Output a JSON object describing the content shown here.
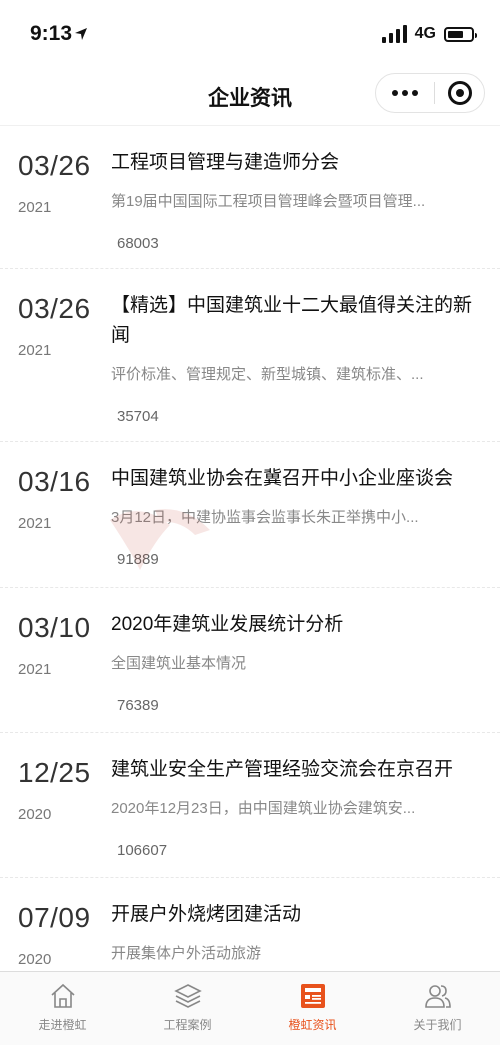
{
  "status_bar": {
    "time": "9:13",
    "network": "4G"
  },
  "nav": {
    "title": "企业资讯"
  },
  "articles": [
    {
      "date_md": "03/26",
      "year": "2021",
      "title": "工程项目管理与建造师分会",
      "summary": "第19届中国国际工程项目管理峰会暨项目管理...",
      "views": "68003"
    },
    {
      "date_md": "03/26",
      "year": "2021",
      "title": "【精选】中国建筑业十二大最值得关注的新闻",
      "summary": "评价标准、管理规定、新型城镇、建筑标准、...",
      "views": "35704"
    },
    {
      "date_md": "03/16",
      "year": "2021",
      "title": "中国建筑业协会在冀召开中小企业座谈会",
      "summary": "3月12日，中建协监事会监事长朱正举携中小...",
      "views": "91889"
    },
    {
      "date_md": "03/10",
      "year": "2021",
      "title": "2020年建筑业发展统计分析",
      "summary": "全国建筑业基本情况",
      "views": "76389"
    },
    {
      "date_md": "12/25",
      "year": "2020",
      "title": "建筑业安全生产管理经验交流会在京召开",
      "summary": "2020年12月23日，由中国建筑业协会建筑安...",
      "views": "106607"
    },
    {
      "date_md": "07/09",
      "year": "2020",
      "title": "开展户外烧烤团建活动",
      "summary": "开展集体户外活动旅游",
      "views": ""
    }
  ],
  "tabs": [
    {
      "label": "走进橙虹",
      "icon": "home-icon",
      "active": false
    },
    {
      "label": "工程案例",
      "icon": "layers-icon",
      "active": false
    },
    {
      "label": "橙虹资讯",
      "icon": "news-icon",
      "active": true
    },
    {
      "label": "关于我们",
      "icon": "users-icon",
      "active": false
    }
  ],
  "colors": {
    "accent": "#e8521c",
    "tab_inactive": "#888888"
  }
}
